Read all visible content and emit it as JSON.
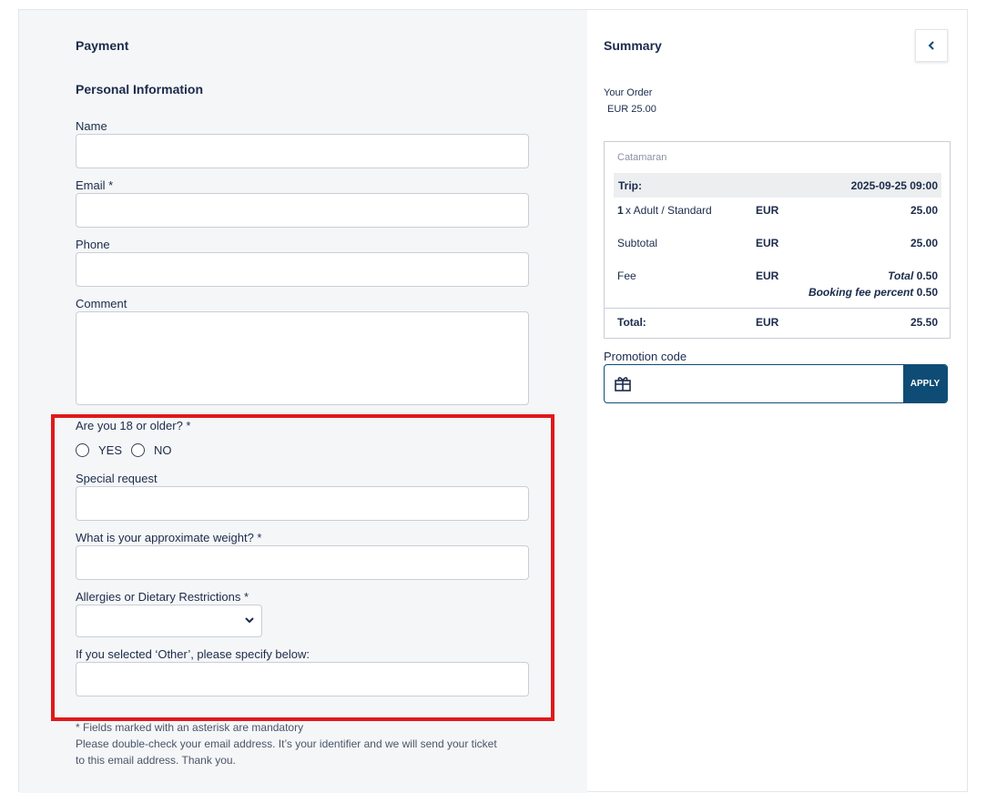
{
  "payment": {
    "title": "Payment",
    "personal_title": "Personal Information",
    "name_label": "Name",
    "email_label": "Email *",
    "phone_label": "Phone",
    "comment_label": "Comment",
    "age_question": "Are you 18 or older? *",
    "yes_label": "YES",
    "no_label": "NO",
    "special_request_label": "Special request",
    "weight_label": "What is your approximate weight? *",
    "allergies_label": "Allergies or Dietary Restrictions *",
    "other_label": "If you selected ‘Other’, please specify below:",
    "footnote_1": "* Fields marked with an asterisk are mandatory",
    "footnote_2": "Please double-check your email address. It’s your identifier and we will send your ticket",
    "footnote_3": "to this email address. Thank you."
  },
  "summary": {
    "title": "Summary",
    "your_order": "Your Order",
    "order_total": "EUR 25.00",
    "product": "Catamaran",
    "trip_label": "Trip:",
    "trip_date": "2025-09-25 09:00",
    "line_qty": "1",
    "line_desc": "x Adult / Standard",
    "line_currency": "EUR",
    "line_amount": "25.00",
    "subtotal_label": "Subtotal",
    "subtotal_currency": "EUR",
    "subtotal_amount": "25.00",
    "fee_label": "Fee",
    "fee_currency": "EUR",
    "fee_total_label": "Total",
    "fee_total": "0.50",
    "fee_percent_label": "Booking fee percent",
    "fee_percent": "0.50",
    "total_label": "Total:",
    "total_currency": "EUR",
    "total_amount": "25.50",
    "promo_label": "Promotion code",
    "apply_label": "APPLY"
  },
  "colors": {
    "accent": "#0f4c75",
    "highlight": "#e0191b",
    "left_bg": "#f5f6f7"
  }
}
